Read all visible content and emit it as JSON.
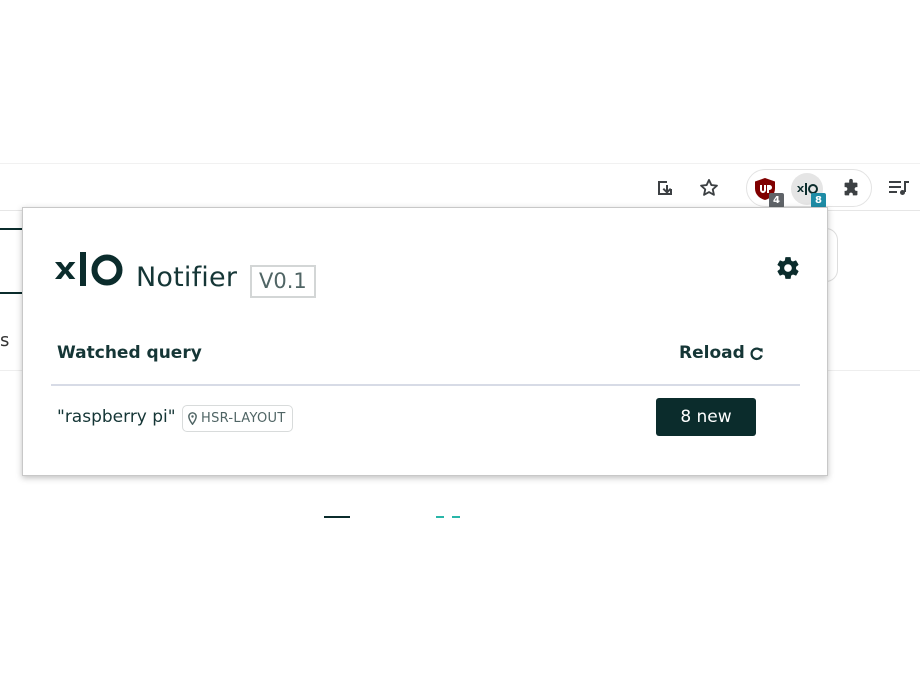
{
  "toolbar": {
    "icons": {
      "download": "install-download-icon",
      "bookmark": "star-icon",
      "ublock": "ublock-origin-icon",
      "xio": "xio-notifier-extension-icon",
      "extensions": "puzzle-piece-icon",
      "queue": "media-queue-icon"
    },
    "ublock_badge": "4",
    "xio_badge": "8"
  },
  "page_behind": {
    "left_letter": "s"
  },
  "popup": {
    "logo_icon": "xio-logo",
    "title": "Notifier",
    "version": "V0.1",
    "settings_icon": "gear-icon",
    "header": {
      "watched_query": "Watched query",
      "reload": "Reload",
      "reload_icon": "refresh-icon"
    },
    "rows": [
      {
        "query": "\"raspberry pi\"",
        "location_icon": "map-pin-icon",
        "location": "HSR-LAYOUT",
        "new_label": "8 new"
      }
    ]
  },
  "colors": {
    "brand_dark": "#0b2c2c",
    "badge_teal": "#1e8ca6",
    "ublock_red": "#800000",
    "divider": "#d7dbe6"
  }
}
